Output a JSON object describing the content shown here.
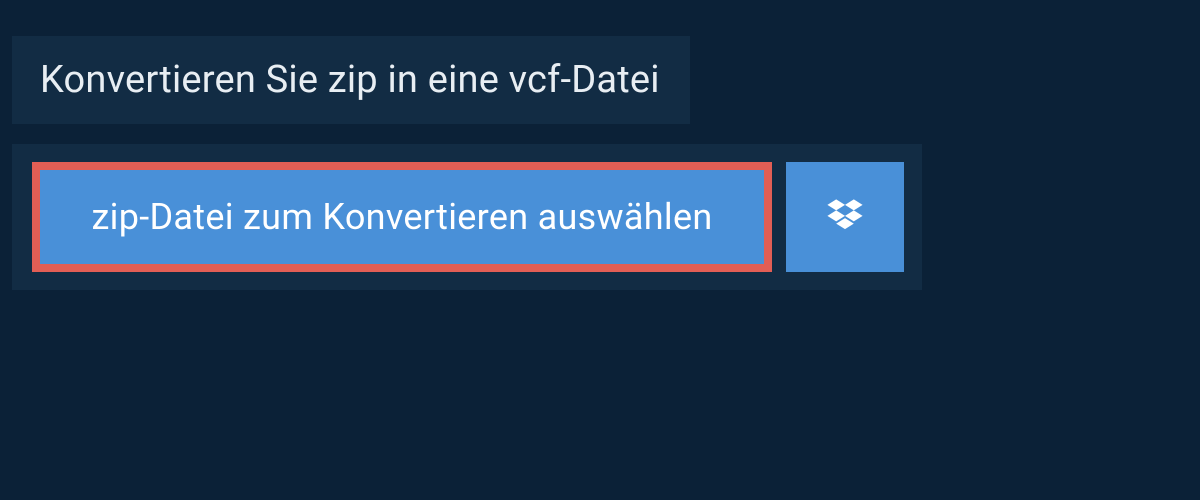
{
  "header": {
    "title": "Konvertieren Sie zip in eine vcf-Datei"
  },
  "upload": {
    "select_label": "zip-Datei zum Konvertieren auswählen"
  },
  "colors": {
    "page_bg": "#0b2137",
    "panel_bg": "#122c44",
    "button_bg": "#4990d8",
    "button_border": "#e25e55",
    "text_light": "#e8eef3",
    "text_white": "#ffffff"
  }
}
